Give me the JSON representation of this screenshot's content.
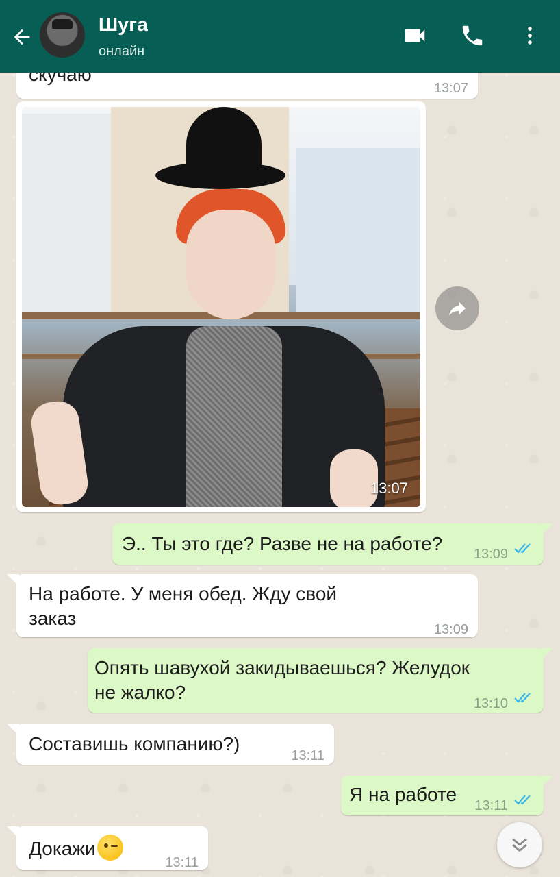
{
  "header": {
    "contact_name": "Шуга",
    "contact_status": "онлайн",
    "bg_color": "#075e54"
  },
  "icons": {
    "back": "arrow-left-icon",
    "video": "video-camera-icon",
    "call": "phone-icon",
    "menu": "more-vertical-icon",
    "forward": "forward-share-icon",
    "scroll": "chevron-double-down-icon",
    "read": "double-check-icon"
  },
  "messages": [
    {
      "direction": "in",
      "text": "скучаю",
      "time": "13:07"
    },
    {
      "direction": "in",
      "type": "image",
      "time": "13:07"
    },
    {
      "direction": "out",
      "text": "Э.. Ты это где? Разве не на работе?",
      "time": "13:09",
      "status": "read"
    },
    {
      "direction": "in",
      "text": "На работе. У меня обед. Жду свой",
      "text2": "заказ",
      "time": "13:09"
    },
    {
      "direction": "out",
      "text": "Опять шавухой закидываешься? Желудок",
      "text2": "не жалко?",
      "time": "13:10",
      "status": "read"
    },
    {
      "direction": "in",
      "text": "Составишь компанию?)",
      "time": "13:11"
    },
    {
      "direction": "out",
      "text": "Я на работе",
      "time": "13:11",
      "status": "read"
    },
    {
      "direction": "in",
      "text": "Докажи",
      "emoji": "winking-face",
      "time": "13:11"
    }
  ],
  "colors": {
    "incoming_bubble": "#ffffff",
    "outgoing_bubble": "#dcf8c6",
    "read_tick": "#34b7f1"
  }
}
